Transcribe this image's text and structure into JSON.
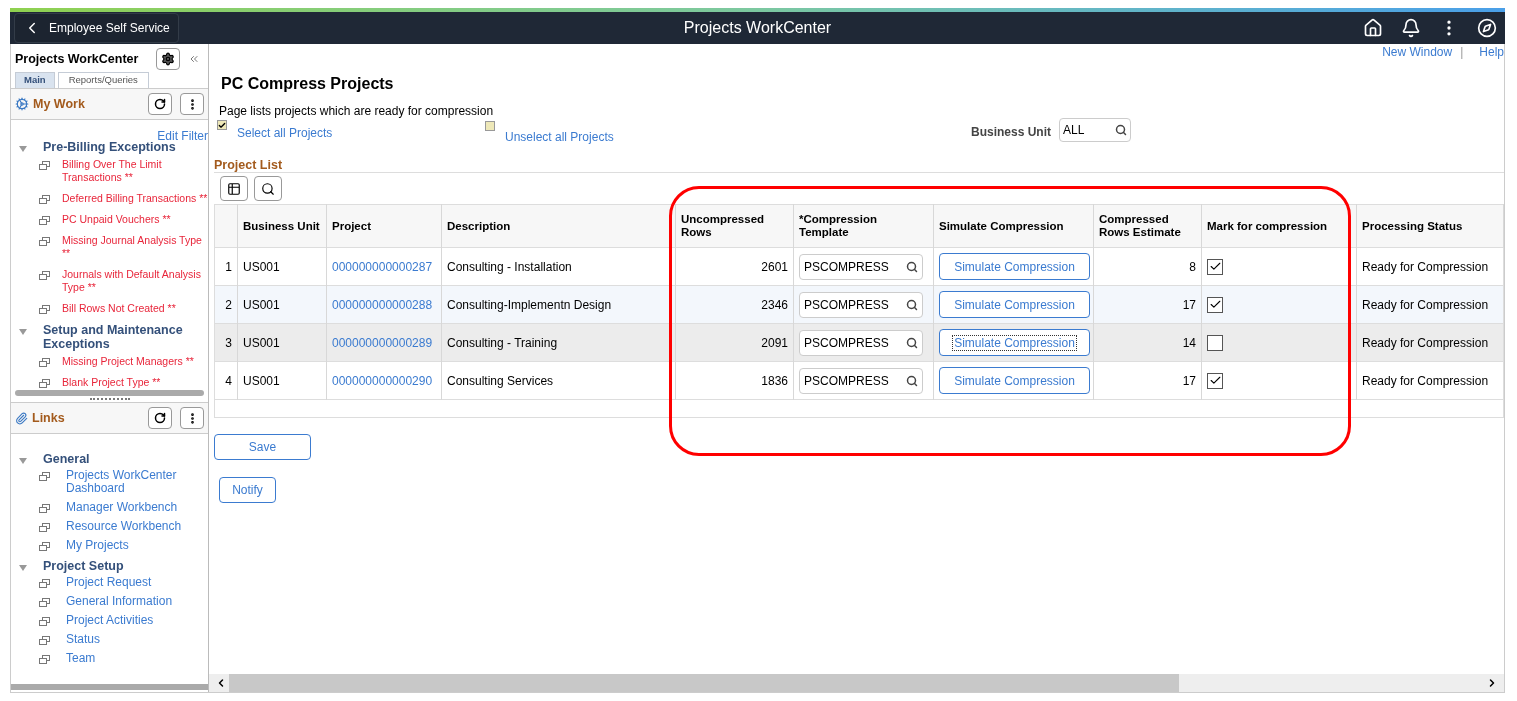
{
  "header": {
    "back_button": "Employee Self Service",
    "title": "Projects WorkCenter"
  },
  "sidebar": {
    "title": "Projects WorkCenter",
    "tabs": [
      {
        "label": "Main",
        "selected": true
      },
      {
        "label": "Reports/Queries",
        "selected": false
      }
    ],
    "my_work": {
      "title": "My Work",
      "edit_filter": "Edit Filter",
      "groups": [
        {
          "label": "Pre-Billing Exceptions",
          "expanded": true,
          "children": [
            {
              "label": "Billing Over The Limit Transactions **"
            },
            {
              "label": "Deferred Billing Transactions **"
            },
            {
              "label": "PC Unpaid Vouchers **"
            },
            {
              "label": "Missing Journal Analysis Type **"
            },
            {
              "label": "Journals with Default Analysis Type **"
            },
            {
              "label": "Bill Rows Not Created **"
            }
          ]
        },
        {
          "label": "Setup and Maintenance Exceptions",
          "expanded": true,
          "children": [
            {
              "label": "Missing Project Managers **"
            },
            {
              "label": "Blank Project Type **"
            }
          ]
        }
      ]
    },
    "links": {
      "title": "Links",
      "groups": [
        {
          "label": "General",
          "expanded": true,
          "children": [
            {
              "label": "Projects WorkCenter Dashboard"
            },
            {
              "label": "Manager Workbench"
            },
            {
              "label": "Resource Workbench"
            },
            {
              "label": "My Projects"
            }
          ]
        },
        {
          "label": "Project Setup",
          "expanded": true,
          "children": [
            {
              "label": "Project Request"
            },
            {
              "label": "General Information"
            },
            {
              "label": "Project Activities"
            },
            {
              "label": "Status"
            },
            {
              "label": "Team"
            }
          ]
        }
      ]
    }
  },
  "top_links": [
    "New Window",
    "Help"
  ],
  "top_links_separator": "|",
  "page_title": "PC Compress Projects",
  "intro": "Page lists projects which are ready for compression",
  "select_all": {
    "label": "Select all Projects",
    "checked": true
  },
  "unselect_all": {
    "label": "Unselect all Projects",
    "checked": false
  },
  "business_unit": {
    "label": "Business Unit",
    "value": "ALL"
  },
  "grid": {
    "title": "Project List",
    "columns": [
      "Business Unit",
      "Project",
      "Description",
      "Uncompressed Rows",
      "*Compression Template",
      "Simulate Compression",
      "Compressed Rows Estimate",
      "Mark for compression",
      "Processing Status"
    ],
    "rows": [
      {
        "num": "1",
        "business_unit": "US001",
        "project": "000000000000287",
        "description": "Consulting - Installation",
        "uncompressed_rows": "2601",
        "template": "PSCOMPRESS",
        "simulate": "Simulate Compression",
        "focused": false,
        "estimate": "8",
        "marked": true,
        "status": "Ready for Compression",
        "selected": false,
        "hover": false
      },
      {
        "num": "2",
        "business_unit": "US001",
        "project": "000000000000288",
        "description": "Consulting-Implementn Design",
        "uncompressed_rows": "2346",
        "template": "PSCOMPRESS",
        "simulate": "Simulate Compression",
        "focused": false,
        "estimate": "17",
        "marked": true,
        "status": "Ready for Compression",
        "selected": false,
        "hover": true
      },
      {
        "num": "3",
        "business_unit": "US001",
        "project": "000000000000289",
        "description": "Consulting - Training",
        "uncompressed_rows": "2091",
        "template": "PSCOMPRESS",
        "simulate": "Simulate Compression",
        "focused": true,
        "estimate": "14",
        "marked": false,
        "status": "Ready for Compression",
        "selected": true,
        "hover": false
      },
      {
        "num": "4",
        "business_unit": "US001",
        "project": "000000000000290",
        "description": "Consulting Services",
        "uncompressed_rows": "1836",
        "template": "PSCOMPRESS",
        "simulate": "Simulate Compression",
        "focused": false,
        "estimate": "17",
        "marked": true,
        "status": "Ready for Compression",
        "selected": false,
        "hover": false
      }
    ]
  },
  "buttons": [
    "Save",
    "Notify"
  ]
}
